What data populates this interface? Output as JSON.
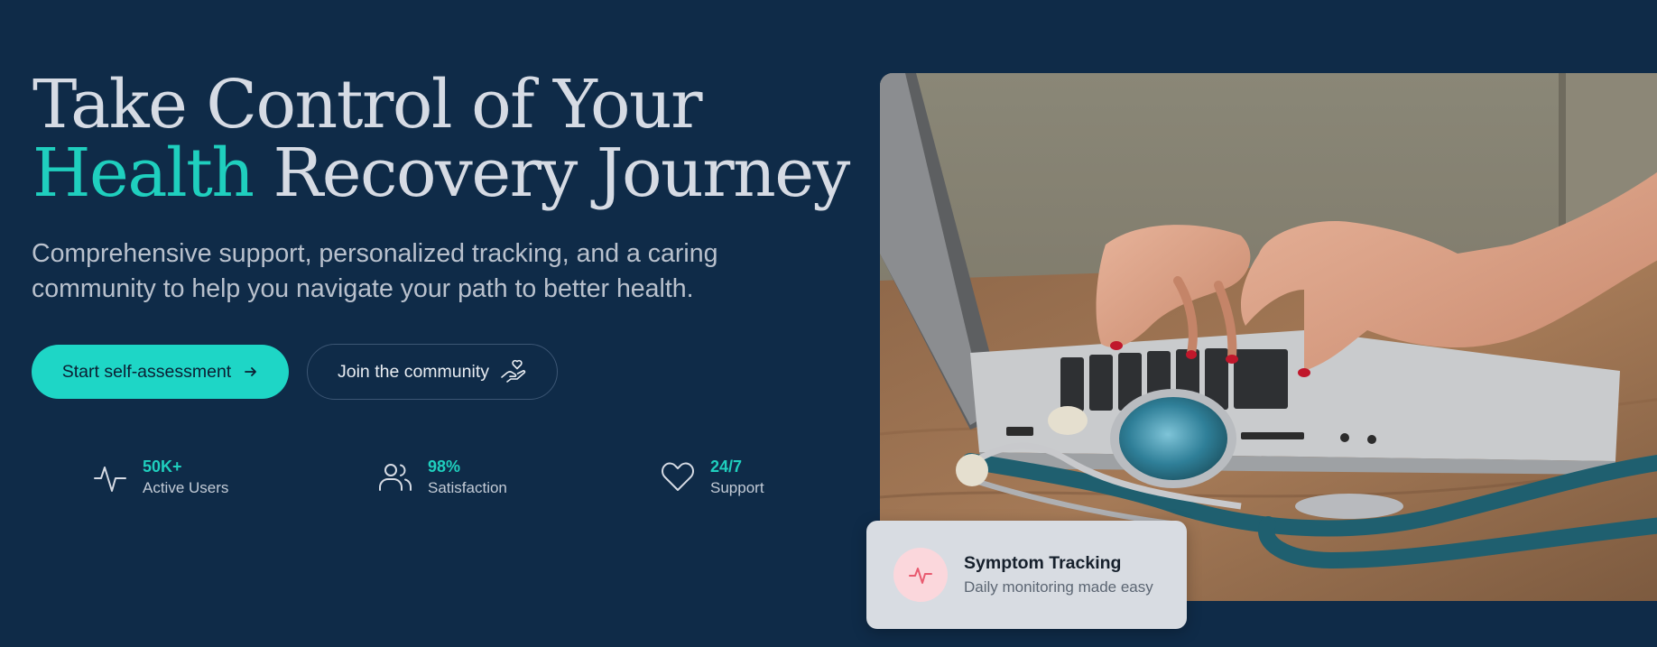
{
  "hero": {
    "title_line1": "Take Control of Your",
    "title_accent": "Health",
    "title_rest": " Recovery Journey",
    "subtitle": "Comprehensive support, personalized tracking, and a caring community to help you navigate your path to better health."
  },
  "buttons": {
    "primary_label": "Start self-assessment",
    "secondary_label": "Join the community"
  },
  "stats": [
    {
      "value": "50K+",
      "label": "Active Users",
      "icon": "activity-icon"
    },
    {
      "value": "98%",
      "label": "Satisfaction",
      "icon": "users-icon"
    },
    {
      "value": "24/7",
      "label": "Support",
      "icon": "heart-icon"
    }
  ],
  "card": {
    "title": "Symptom Tracking",
    "subtitle": "Daily monitoring made easy",
    "icon": "pulse-icon"
  },
  "colors": {
    "background": "#0f2b48",
    "accent": "#1fcfbe",
    "card_badge": "#fbd7dc",
    "card_icon": "#e85a6f"
  },
  "image": {
    "alt": "Hands typing on a laptop with a stethoscope on a wooden desk"
  }
}
